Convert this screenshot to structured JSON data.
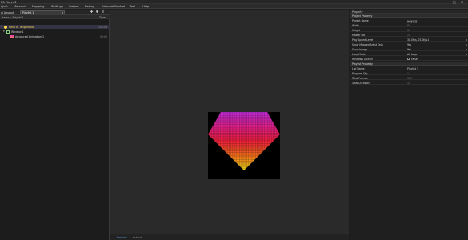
{
  "app": {
    "title": "RS Player 3"
  },
  "window_controls": [
    "—",
    "□",
    "✕"
  ],
  "menu": [
    "oject",
    "Material",
    "Mapping",
    "Settings",
    "Output",
    "Debug",
    "External Control",
    "Tool",
    "Help"
  ],
  "left": {
    "toolbar_label": "al Amount",
    "select_value": "Playlist 1",
    "header": {
      "name": "Name = Playlist 1",
      "time": "Time"
    },
    "tree": [
      {
        "label": "Hello to Tangorama",
        "value": "00:05s",
        "color": "#ffd84a"
      },
      {
        "label": "Window 1",
        "value": ""
      },
      {
        "label": "Advanced Animation 1",
        "value": "00:05"
      }
    ]
  },
  "center": {
    "tabs": [
      "Preview",
      "Output"
    ]
  },
  "right": {
    "title": "Property",
    "sections": [
      "Project Property",
      "Playlist Property"
    ],
    "project_props": [
      {
        "key": "Project Name",
        "value": "新建项目1",
        "dim": false
      },
      {
        "key": "Width",
        "value": "80",
        "dim": true
      },
      {
        "key": "Height",
        "value": "64",
        "dim": true
      },
      {
        "key": "Master Ips",
        "value": "14",
        "dim": true
      },
      {
        "key": "Play Speed Level",
        "value": "30.0fps, 25.0fps1",
        "dim": false
      },
      {
        "key": "Show Mapped Artist Only",
        "value": "Yes",
        "dim": false
      },
      {
        "key": "Show Image",
        "value": "Yes",
        "dim": false
      },
      {
        "key": "Loop Mode",
        "value": "All Loop",
        "dim": false
      },
      {
        "key": "Windows Locked",
        "value": "False",
        "dim": false
      }
    ],
    "playlist_props": [
      {
        "key": "List Name",
        "value": "Playlist 1",
        "dim": false
      },
      {
        "key": "Program Qty",
        "value": "1",
        "dim": true
      },
      {
        "key": "Total Frames",
        "value": "300",
        "dim": true
      },
      {
        "key": "Total Duration",
        "value": "10",
        "dim": true
      }
    ]
  },
  "colors": {
    "accent": "#5b8fd6",
    "selected_row": "#333344"
  }
}
